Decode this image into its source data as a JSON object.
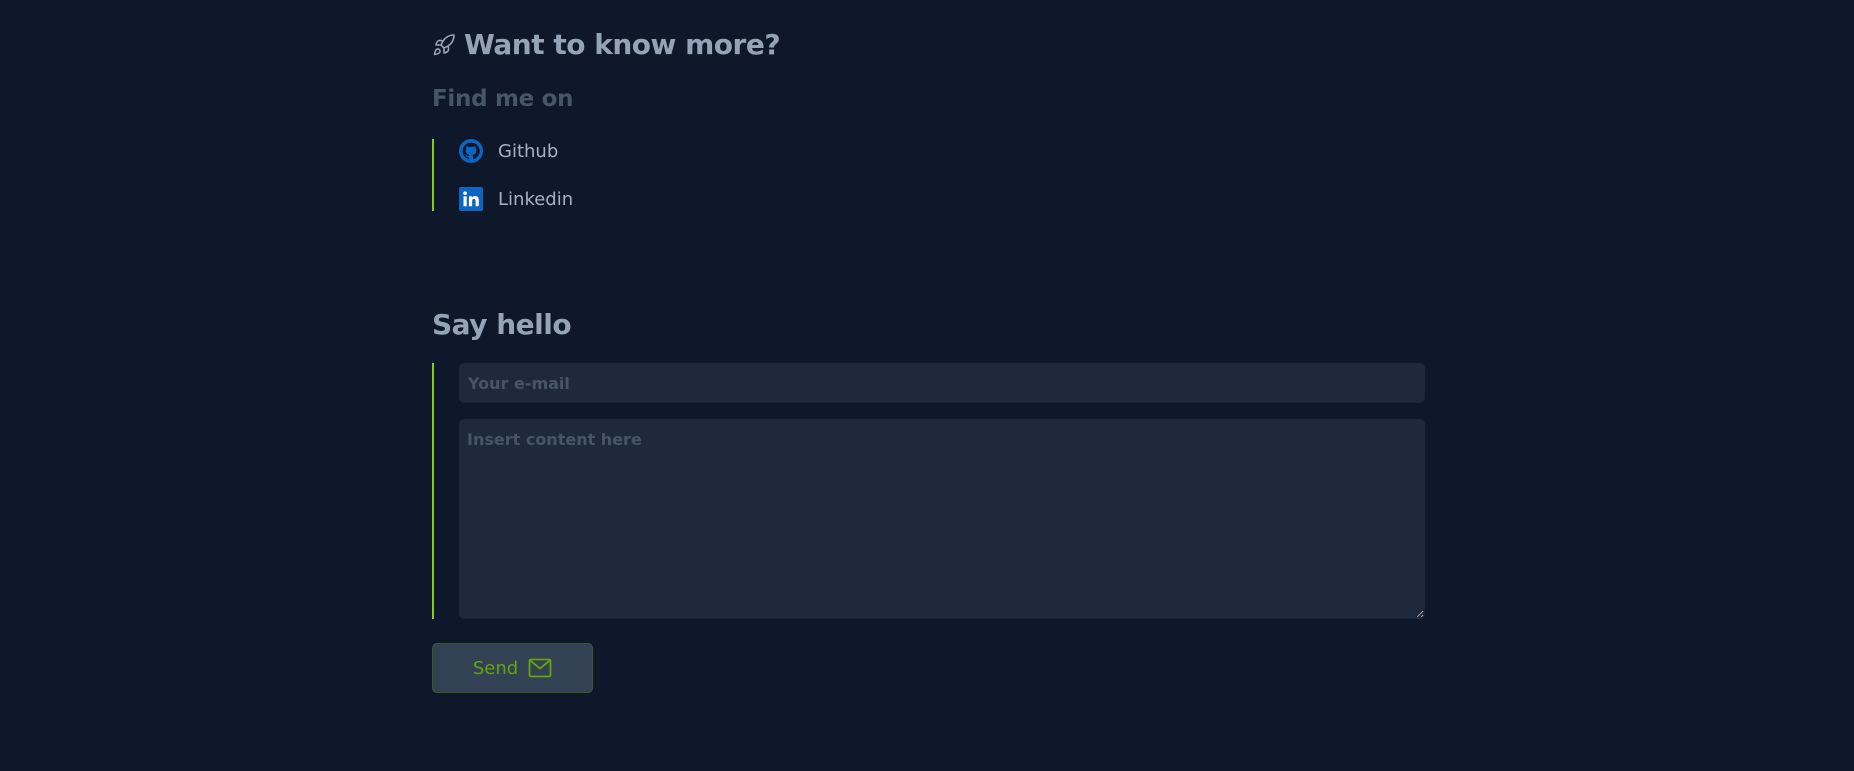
{
  "header": {
    "title": "Want to know more?",
    "title_icon": "rocket-icon"
  },
  "find_me": {
    "title": "Find me on",
    "links": [
      {
        "label": "Github",
        "icon": "github-icon"
      },
      {
        "label": "Linkedin",
        "icon": "linkedin-icon"
      }
    ]
  },
  "contact": {
    "title": "Say hello",
    "email_placeholder": "Your e-mail",
    "email_value": "",
    "content_placeholder": "Insert content here",
    "content_value": "",
    "send_label": "Send",
    "send_icon": "envelope-icon"
  },
  "colors": {
    "background": "#0f172a",
    "accent": "#84cc16",
    "field_bg": "#1e293b",
    "heading": "#94a3b8",
    "muted": "#475569",
    "github_blue": "#0a66c2",
    "linkedin_blue": "#0a66c2"
  }
}
